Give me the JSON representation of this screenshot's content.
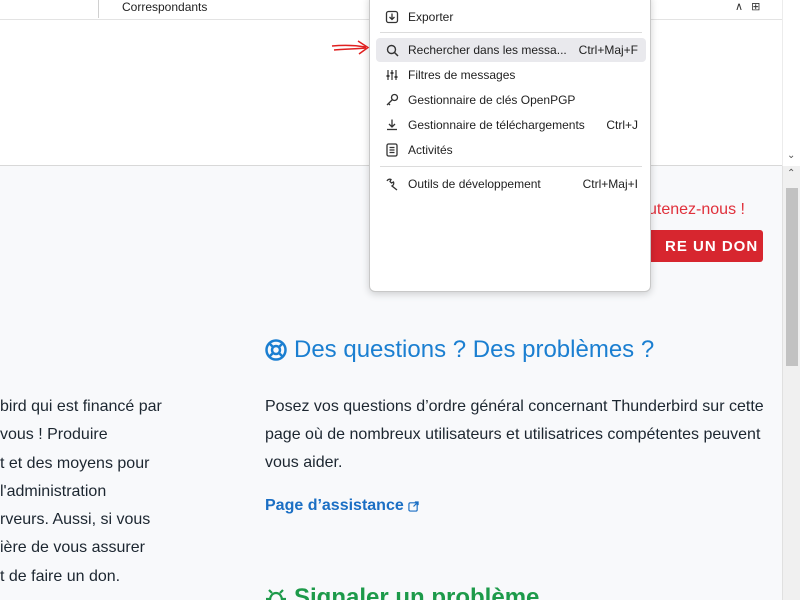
{
  "top_bar": {
    "column_header": "Correspondants",
    "controls": [
      "∧",
      "⊞"
    ]
  },
  "menu": {
    "items": [
      {
        "label": "Exporter",
        "shortcut": "",
        "icon": "export-icon"
      },
      {
        "label": "Rechercher dans les messa...",
        "shortcut": "Ctrl+Maj+F",
        "icon": "search-icon",
        "highlighted": true
      },
      {
        "label": "Filtres de messages",
        "shortcut": "",
        "icon": "filters-icon"
      },
      {
        "label": "Gestionnaire de clés OpenPGP",
        "shortcut": "",
        "icon": "key-icon"
      },
      {
        "label": "Gestionnaire de téléchargements",
        "shortcut": "Ctrl+J",
        "icon": "download-icon"
      },
      {
        "label": "Activités",
        "shortcut": "",
        "icon": "activity-icon"
      },
      {
        "label": "Outils de développement",
        "shortcut": "Ctrl+Maj+I",
        "icon": "wrench-icon"
      }
    ]
  },
  "content": {
    "support_text": "utenez-nous !",
    "donate_button": "RE UN DON",
    "left_paragraph_lines": [
      "bird qui est financé par",
      "vous ! Produire",
      "t et des moyens pour",
      "l'administration",
      "rveurs. Aussi, si vous",
      "ière de vous assurer",
      "t de faire un don."
    ],
    "questions": {
      "heading": "Des questions ? Des problèmes ?",
      "paragraph": "Posez vos questions d’ordre général concernant Thunderbird sur cette page où de nombreux utilisateurs et utilisatrices compétentes peuvent vous aider.",
      "link": "Page d’assistance"
    },
    "bug": {
      "heading": "Signaler un problème"
    }
  },
  "colors": {
    "accent_blue": "#1b7fd1",
    "donate_red": "#d7262f",
    "bug_green": "#1d9a4a",
    "annotation_red": "#e02020"
  }
}
